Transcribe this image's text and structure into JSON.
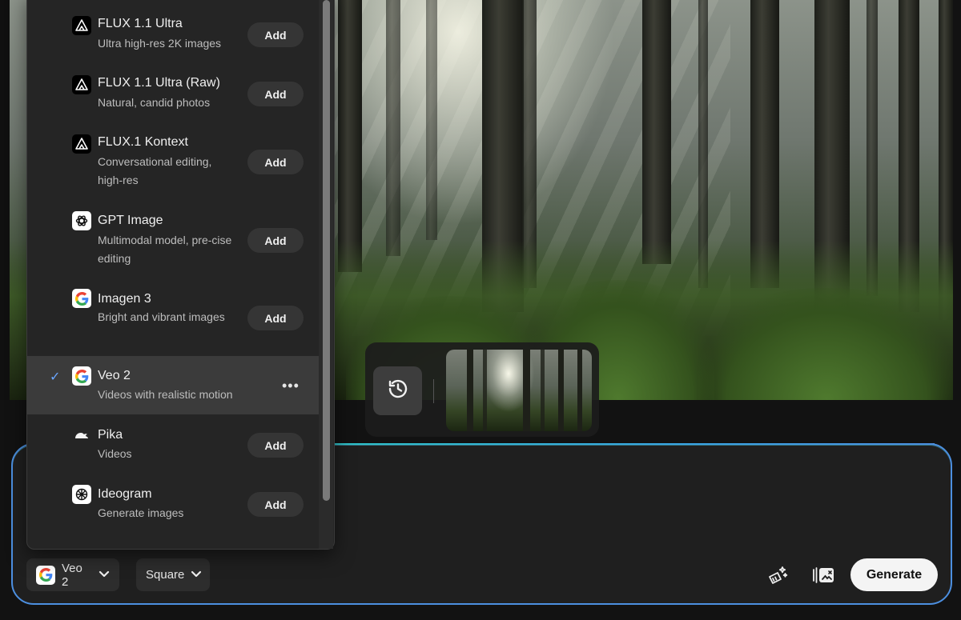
{
  "models_menu": {
    "items": [
      {
        "name": "FLUX 1.1 Ultra",
        "desc": "Ultra high-res 2K images",
        "logo": "bfl-triangle-icon",
        "action": "Add"
      },
      {
        "name": "FLUX 1.1 Ultra (Raw)",
        "desc": "Natural, candid photos",
        "logo": "bfl-triangle-icon",
        "action": "Add"
      },
      {
        "name": "FLUX.1 Kontext",
        "desc": "Conversational editing, high-res",
        "logo": "bfl-triangle-icon",
        "action": "Add"
      },
      {
        "name": "GPT Image",
        "desc": "Multimodal model, pre-cise editing",
        "logo": "openai-icon",
        "action": "Add"
      },
      {
        "name": "Imagen 3",
        "desc": "Bright and vibrant images",
        "logo": "google-icon",
        "action": "Add"
      },
      {
        "name": "Veo 2",
        "desc": "Videos with realistic motion",
        "logo": "google-icon",
        "selected": true,
        "check": "✓",
        "more": "•••"
      },
      {
        "name": "Pika",
        "desc": "Videos",
        "logo": "pika-icon",
        "action": "Add"
      },
      {
        "name": "Ideogram",
        "desc": "Generate images",
        "logo": "ideogram-icon",
        "action": "Add"
      }
    ]
  },
  "toolbar": {
    "model_selector": "Veo 2",
    "aspect_selector": "Square",
    "generate_label": "Generate"
  },
  "colors": {
    "accent": "#4c8fe0",
    "check": "#6aa6ff",
    "panel": "#252525",
    "selected_row": "#3b3b3b"
  }
}
